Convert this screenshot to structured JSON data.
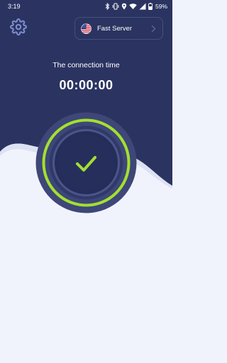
{
  "status_bar": {
    "time": "3:19",
    "battery": "59%",
    "icons": [
      "bluetooth-icon",
      "vibrate-icon",
      "location-icon",
      "wifi-icon",
      "signal-icon",
      "battery-icon"
    ]
  },
  "header": {
    "settings_icon": "gear-icon",
    "server": {
      "flag_icon": "us-flag-icon",
      "label": "Fast Server",
      "chevron_icon": "chevron-right-icon"
    }
  },
  "connection": {
    "label": "The connection time",
    "time": "00:00:00",
    "status_icon": "checkmark-icon"
  },
  "colors": {
    "primary_dark": "#2b3461",
    "background_light": "#f1f3fc",
    "accent_green": "#a3e030",
    "ring_inner": "#3e4777"
  }
}
